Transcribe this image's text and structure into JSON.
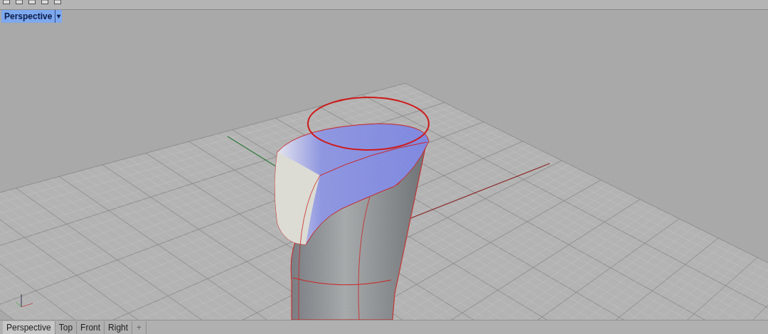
{
  "viewport": {
    "title": "Perspective",
    "menu_glyph": "▾"
  },
  "tabs": [
    {
      "label": "Perspective",
      "selected": true
    },
    {
      "label": "Top",
      "selected": false
    },
    {
      "label": "Front",
      "selected": false
    },
    {
      "label": "Right",
      "selected": false
    }
  ],
  "add_tab_glyph": "+"
}
